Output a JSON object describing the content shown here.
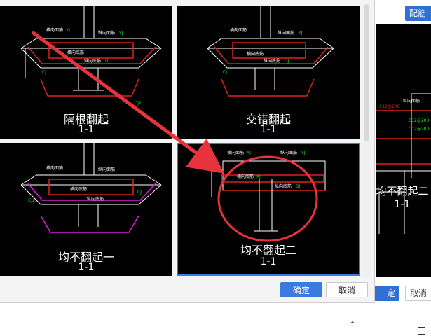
{
  "dialog": {
    "options": [
      {
        "label": "隔根翻起",
        "section": "1-1",
        "selected": false
      },
      {
        "label": "交错翻起",
        "section": "1-1",
        "selected": false
      },
      {
        "label": "均不翻起一",
        "section": "1-1",
        "selected": false
      },
      {
        "label": "均不翻起二",
        "section": "1-1",
        "selected": true
      }
    ],
    "diagram_labels": {
      "transverse_top": "横向面筋",
      "longitudinal_top": "纵向面筋",
      "transverse_bottom": "横向底筋",
      "longitudinal_bottom": "纵向底筋",
      "code_yj": "YJ",
      "code_xj": "XJ",
      "code_dj": "DJ",
      "code_cj": "CJ",
      "code_cj2": "CJ2"
    },
    "ok_label": "确定",
    "cancel_label": "取消"
  },
  "background_window": {
    "top_button_label": "配筋",
    "option_label": "均不翻起二",
    "section": "1-1",
    "ok_label": "定",
    "cancel_label": "取消"
  },
  "annotation": {
    "arrow_color": "#e8323c",
    "circle_color": "#e8323c"
  },
  "colors": {
    "selected_border": "#3b7be0",
    "primary": "#3b7be0",
    "drawing_red": "#e0201c",
    "drawing_green": "#19e019",
    "drawing_white": "#ffffff",
    "drawing_magenta": "#e01ce0"
  }
}
